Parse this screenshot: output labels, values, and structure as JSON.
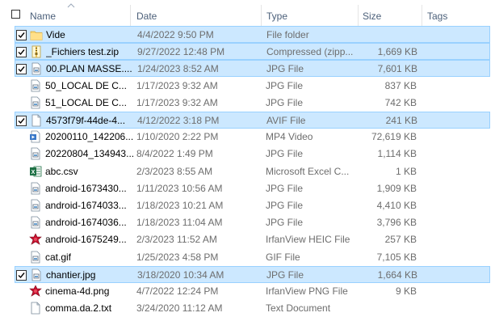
{
  "columns": {
    "name": "Name",
    "date": "Date",
    "type": "Type",
    "size": "Size",
    "tags": "Tags"
  },
  "colors": {
    "selected_bg": "#cce8ff",
    "selected_border": "#99d1ff",
    "header_text": "#4c607a"
  },
  "rows": [
    {
      "name": "Vide",
      "date": "4/4/2022 9:50 PM",
      "type": "File folder",
      "size": "",
      "icon": "folder-icon",
      "checked": true
    },
    {
      "name": "_Fichiers test.zip",
      "date": "9/27/2022 12:48 PM",
      "type": "Compressed (zipp...",
      "size": "1,669 KB",
      "icon": "zip-icon",
      "checked": true
    },
    {
      "name": "00.PLAN MASSE....",
      "date": "1/24/2023 8:52 AM",
      "type": "JPG File",
      "size": "7,601 KB",
      "icon": "image-file-icon",
      "checked": true
    },
    {
      "name": "50_LOCAL DE C...",
      "date": "1/17/2023 9:32 AM",
      "type": "JPG File",
      "size": "837 KB",
      "icon": "image-file-icon",
      "checked": false
    },
    {
      "name": "51_LOCAL DE C...",
      "date": "1/17/2023 9:32 AM",
      "type": "JPG File",
      "size": "742 KB",
      "icon": "image-file-icon",
      "checked": false
    },
    {
      "name": "4573f79f-44de-4...",
      "date": "4/12/2022 3:18 PM",
      "type": "AVIF File",
      "size": "241 KB",
      "icon": "blank-file-icon",
      "checked": true
    },
    {
      "name": "20200110_142206...",
      "date": "1/10/2020 2:22 PM",
      "type": "MP4 Video",
      "size": "72,619 KB",
      "icon": "video-file-icon",
      "checked": false
    },
    {
      "name": "20220804_134943...",
      "date": "8/4/2022 1:49 PM",
      "type": "JPG File",
      "size": "1,114 KB",
      "icon": "image-file-icon",
      "checked": false
    },
    {
      "name": "abc.csv",
      "date": "2/3/2023 8:55 AM",
      "type": "Microsoft Excel C...",
      "size": "1 KB",
      "icon": "excel-icon",
      "checked": false
    },
    {
      "name": "android-1673430...",
      "date": "1/11/2023 10:56 AM",
      "type": "JPG File",
      "size": "1,909 KB",
      "icon": "image-file-icon",
      "checked": false
    },
    {
      "name": "android-1674033...",
      "date": "1/18/2023 10:21 AM",
      "type": "JPG File",
      "size": "4,410 KB",
      "icon": "image-file-icon",
      "checked": false
    },
    {
      "name": "android-1674036...",
      "date": "1/18/2023 11:04 AM",
      "type": "JPG File",
      "size": "3,796 KB",
      "icon": "image-file-icon",
      "checked": false
    },
    {
      "name": "android-1675249...",
      "date": "2/3/2023 11:52 AM",
      "type": "IrfanView HEIC File",
      "size": "257 KB",
      "icon": "irfanview-icon",
      "checked": false
    },
    {
      "name": "cat.gif",
      "date": "1/25/2023 4:58 PM",
      "type": "GIF File",
      "size": "7,105 KB",
      "icon": "image-file-icon",
      "checked": false
    },
    {
      "name": "chantier.jpg",
      "date": "3/18/2020 10:34 AM",
      "type": "JPG File",
      "size": "1,664 KB",
      "icon": "image-file-icon",
      "checked": true
    },
    {
      "name": "cinema-4d.png",
      "date": "4/7/2022 12:24 PM",
      "type": "IrfanView PNG File",
      "size": "9 KB",
      "icon": "irfanview-icon",
      "checked": false
    },
    {
      "name": "comma.da.2.txt",
      "date": "3/24/2020 11:12 AM",
      "type": "Text Document",
      "size": "",
      "icon": "blank-file-icon",
      "checked": false
    }
  ]
}
